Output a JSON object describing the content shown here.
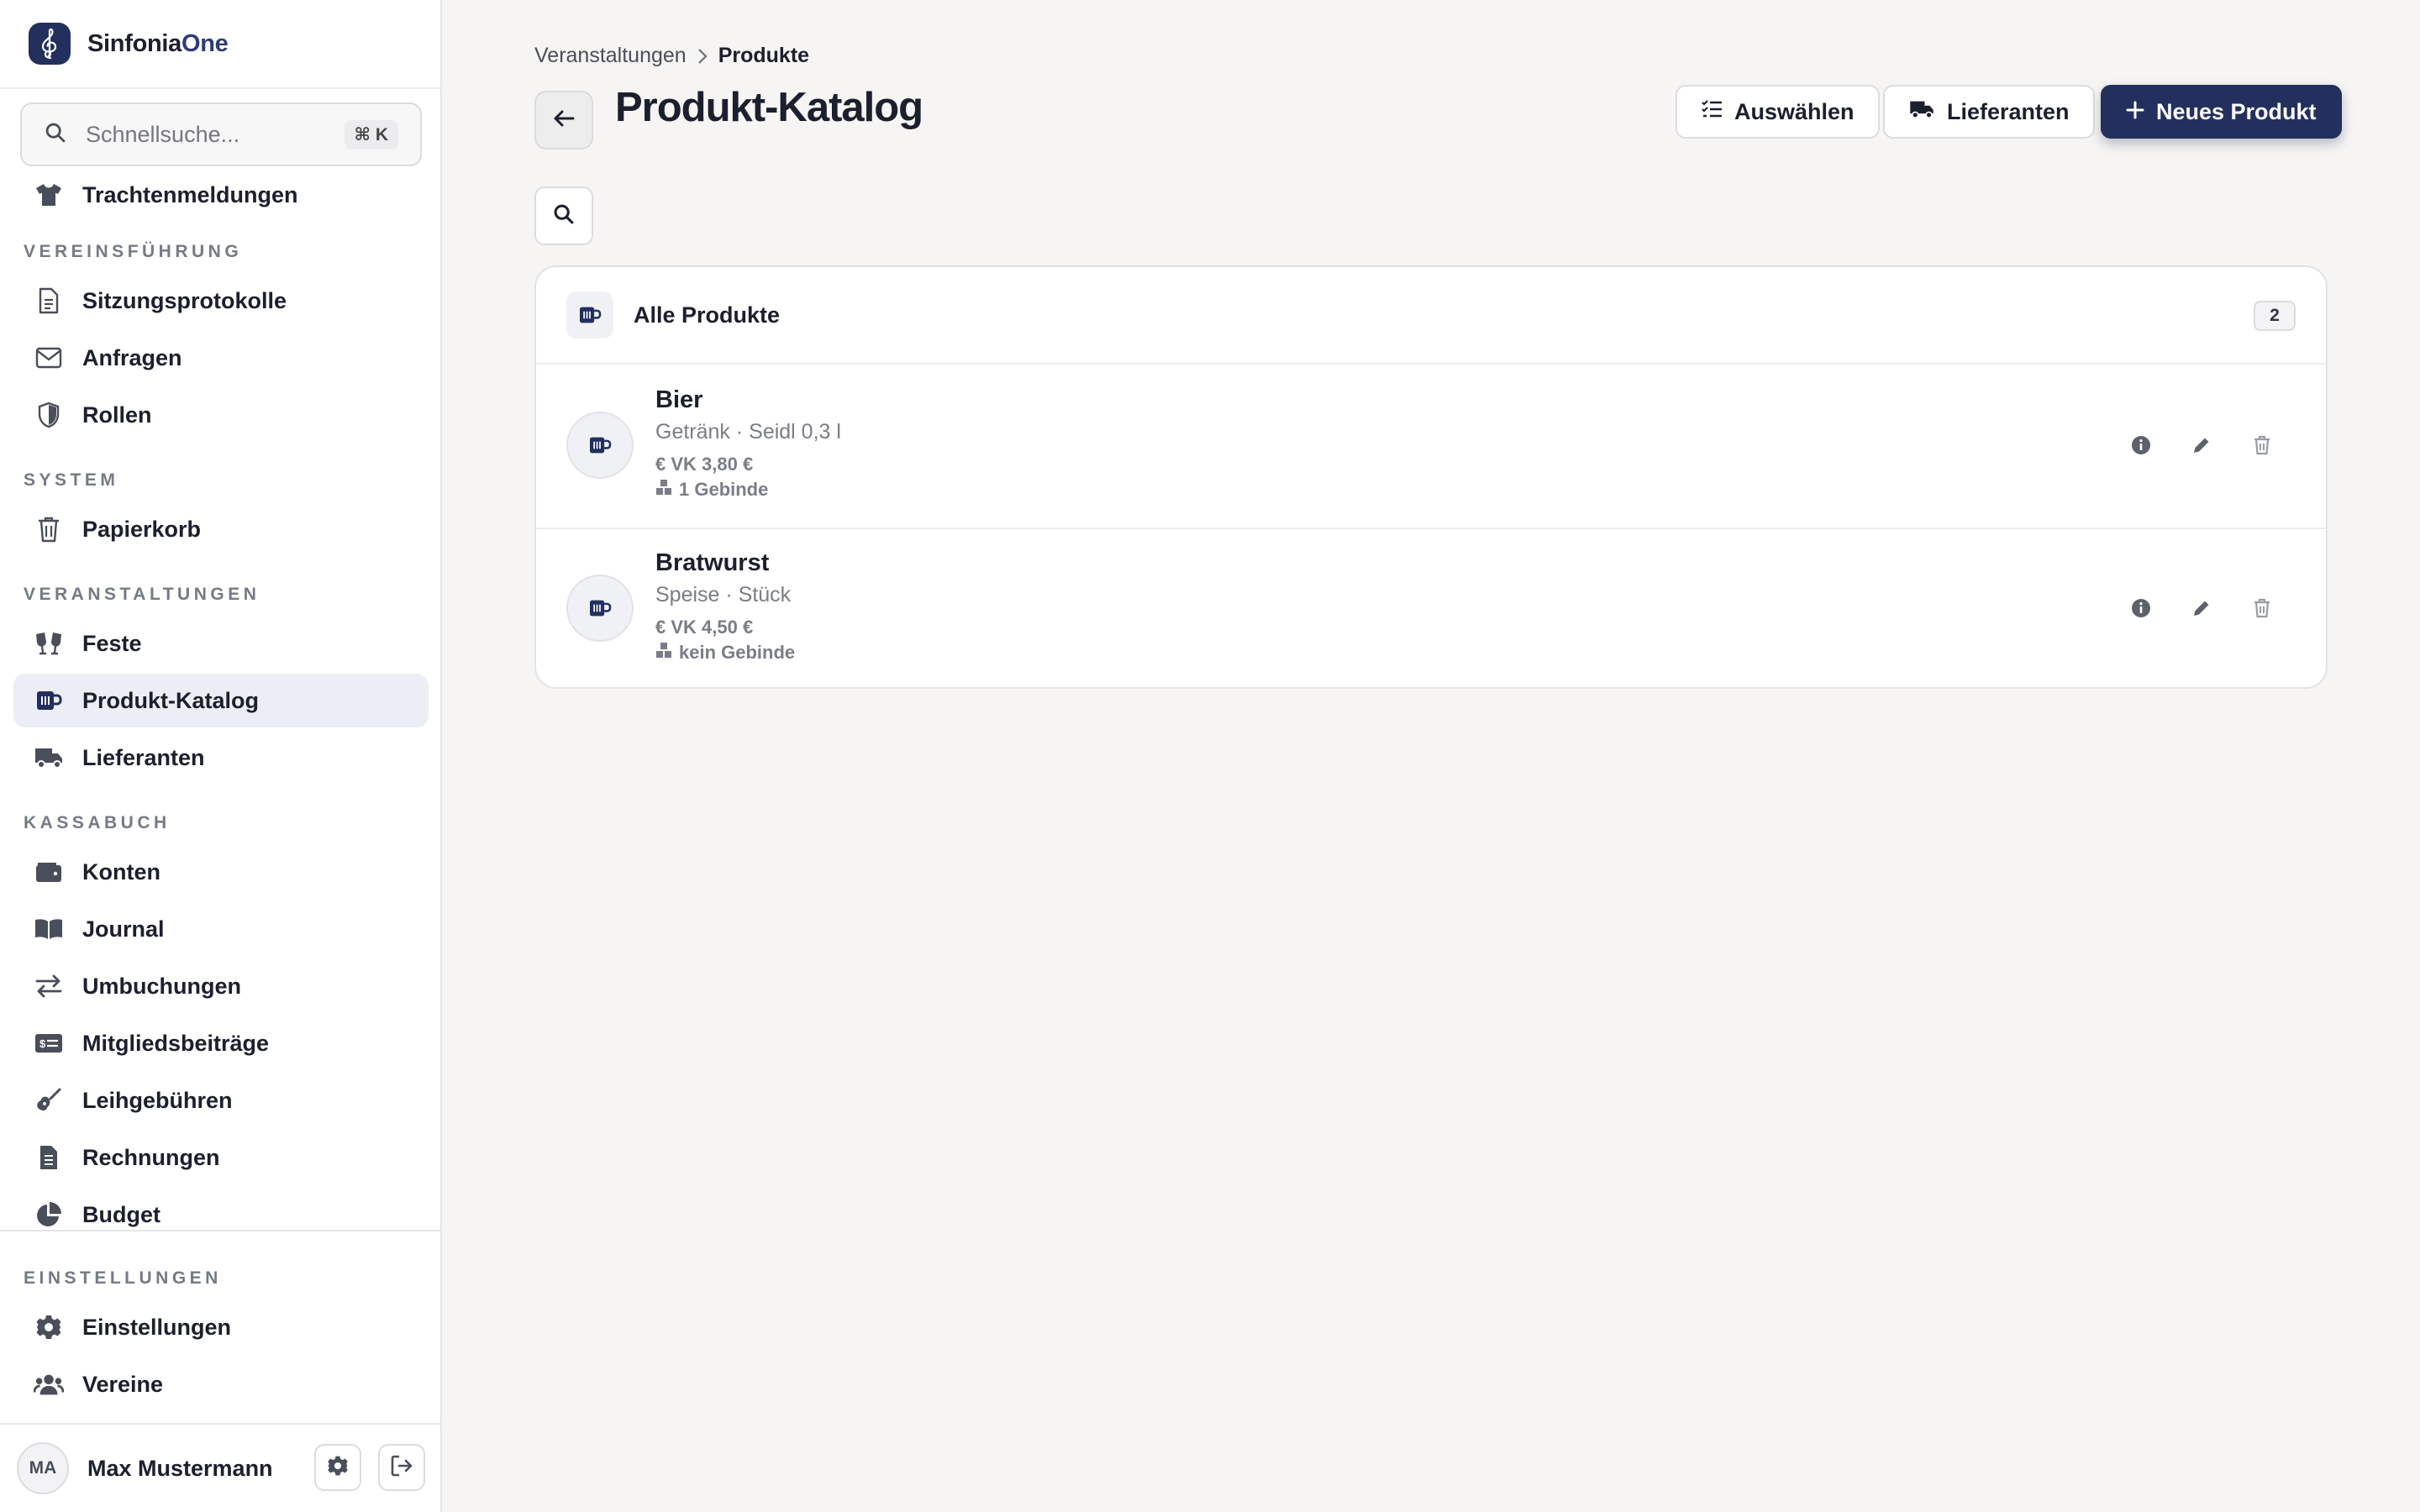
{
  "app": {
    "name_main": "Sinfonia",
    "name_accent": "One"
  },
  "search": {
    "placeholder": "Schnellsuche...",
    "shortcut": "⌘ K"
  },
  "sidebar": {
    "top_item": {
      "label": "Trachtenmeldungen",
      "icon": "shirt-icon"
    },
    "sections": [
      {
        "title": "VEREINSFÜHRUNG",
        "items": [
          {
            "label": "Sitzungsprotokolle",
            "icon": "document-icon"
          },
          {
            "label": "Anfragen",
            "icon": "envelope-icon"
          },
          {
            "label": "Rollen",
            "icon": "shield-icon"
          }
        ]
      },
      {
        "title": "SYSTEM",
        "items": [
          {
            "label": "Papierkorb",
            "icon": "trash-icon"
          }
        ]
      },
      {
        "title": "VERANSTALTUNGEN",
        "items": [
          {
            "label": "Feste",
            "icon": "glasses-cheers-icon"
          },
          {
            "label": "Produkt-Katalog",
            "icon": "mug-icon",
            "active": true
          },
          {
            "label": "Lieferanten",
            "icon": "truck-icon"
          }
        ]
      },
      {
        "title": "KASSABUCH",
        "items": [
          {
            "label": "Konten",
            "icon": "wallet-icon"
          },
          {
            "label": "Journal",
            "icon": "book-icon"
          },
          {
            "label": "Umbuchungen",
            "icon": "transfer-icon"
          },
          {
            "label": "Mitgliedsbeiträge",
            "icon": "money-card-icon"
          },
          {
            "label": "Leihgebühren",
            "icon": "guitar-icon"
          },
          {
            "label": "Rechnungen",
            "icon": "invoice-icon"
          },
          {
            "label": "Budget",
            "icon": "pie-chart-icon"
          }
        ]
      }
    ],
    "bottom_section": {
      "title": "EINSTELLUNGEN",
      "items": [
        {
          "label": "Einstellungen",
          "icon": "gear-icon"
        },
        {
          "label": "Vereine",
          "icon": "users-icon"
        }
      ]
    },
    "user": {
      "initials": "MA",
      "name": "Max Mustermann"
    }
  },
  "breadcrumb": {
    "parent": "Veranstaltungen",
    "current": "Produkte"
  },
  "page": {
    "title": "Produkt-Katalog"
  },
  "toolbar": {
    "select_label": "Auswählen",
    "suppliers_label": "Lieferanten",
    "new_label": "Neues Produkt"
  },
  "catalog": {
    "group_title": "Alle Produkte",
    "count": "2",
    "products": [
      {
        "name": "Bier",
        "subtitle": "Getränk · Seidl 0,3 l",
        "price": "€ VK 3,80 €",
        "packaging": "1 Gebinde"
      },
      {
        "name": "Bratwurst",
        "subtitle": "Speise · Stück",
        "price": "€ VK 4,50 €",
        "packaging": "kein Gebinde"
      }
    ]
  },
  "colors": {
    "brand": "#23305e",
    "active_bg": "#eceef5",
    "muted_text": "#7a7d86"
  }
}
